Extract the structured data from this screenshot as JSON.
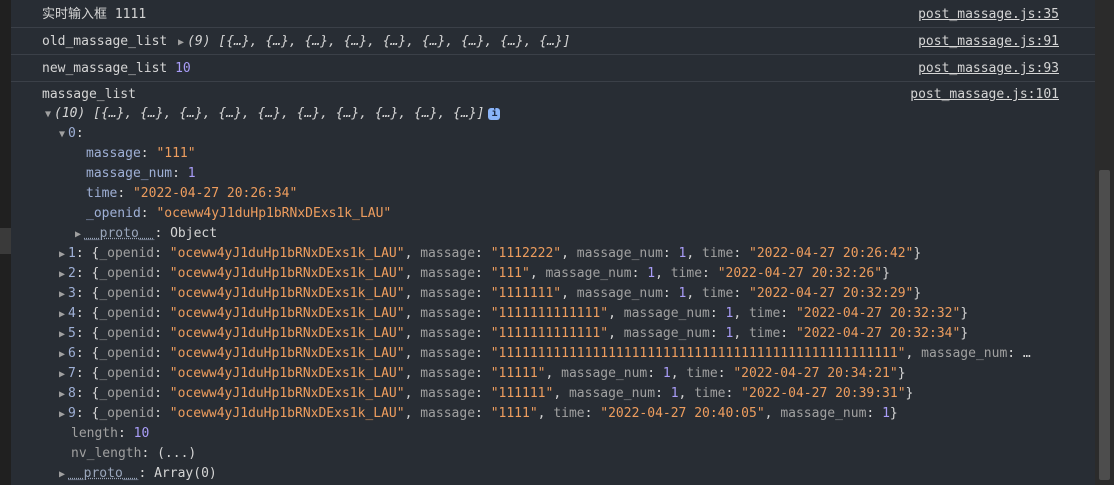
{
  "console": {
    "messages": [
      {
        "label": "实时输入框",
        "value": "1111",
        "source": "post_massage.js:35"
      },
      {
        "label": "old_massage_list",
        "count": "(9)",
        "preview": "[{…}, {…}, {…}, {…}, {…}, {…}, {…}, {…}, {…}]",
        "source": "post_massage.js:91"
      },
      {
        "label": "new_massage_list",
        "value": "10",
        "source": "post_massage.js:93"
      },
      {
        "label": "massage_list",
        "source": "post_massage.js:101"
      }
    ],
    "expanded": {
      "header_count": "(10)",
      "header_preview": "[{…}, {…}, {…}, {…}, {…}, {…}, {…}, {…}, {…}, {…}]",
      "info_icon": "i",
      "item0": {
        "index": "0",
        "props": [
          {
            "key": "massage",
            "value": "\"111\"",
            "type": "str"
          },
          {
            "key": "massage_num",
            "value": "1",
            "type": "num"
          },
          {
            "key": "time",
            "value": "\"2022-04-27 20:26:34\"",
            "type": "str"
          },
          {
            "key": "_openid",
            "value": "\"oceww4yJ1duHp1bRNxDExs1k_LAU\"",
            "type": "str"
          }
        ],
        "proto_label": "__proto__",
        "proto_value": "Object"
      },
      "rows": [
        {
          "index": "1",
          "openid": "\"oceww4yJ1duHp1bRNxDExs1k_LAU\"",
          "f2": "massage",
          "v2": "\"1112222\"",
          "f3": "massage_num",
          "v3": "1",
          "f4": "time",
          "v4": "\"2022-04-27 20:26:42\""
        },
        {
          "index": "2",
          "openid": "\"oceww4yJ1duHp1bRNxDExs1k_LAU\"",
          "f2": "massage",
          "v2": "\"111\"",
          "f3": "massage_num",
          "v3": "1",
          "f4": "time",
          "v4": "\"2022-04-27 20:32:26\""
        },
        {
          "index": "3",
          "openid": "\"oceww4yJ1duHp1bRNxDExs1k_LAU\"",
          "f2": "massage",
          "v2": "\"1111111\"",
          "f3": "massage_num",
          "v3": "1",
          "f4": "time",
          "v4": "\"2022-04-27 20:32:29\""
        },
        {
          "index": "4",
          "openid": "\"oceww4yJ1duHp1bRNxDExs1k_LAU\"",
          "f2": "massage",
          "v2": "\"1111111111111\"",
          "f3": "massage_num",
          "v3": "1",
          "f4": "time",
          "v4": "\"2022-04-27 20:32:32\""
        },
        {
          "index": "5",
          "openid": "\"oceww4yJ1duHp1bRNxDExs1k_LAU\"",
          "f2": "massage",
          "v2": "\"1111111111111\"",
          "f3": "massage_num",
          "v3": "1",
          "f4": "time",
          "v4": "\"2022-04-27 20:32:34\""
        },
        {
          "index": "7",
          "openid": "\"oceww4yJ1duHp1bRNxDExs1k_LAU\"",
          "f2": "massage",
          "v2": "\"11111\"",
          "f3": "massage_num",
          "v3": "1",
          "f4": "time",
          "v4": "\"2022-04-27 20:34:21\""
        },
        {
          "index": "8",
          "openid": "\"oceww4yJ1duHp1bRNxDExs1k_LAU\"",
          "f2": "massage",
          "v2": "\"111111\"",
          "f3": "massage_num",
          "v3": "1",
          "f4": "time",
          "v4": "\"2022-04-27 20:39:31\""
        }
      ],
      "row6": {
        "index": "6",
        "openid": "\"oceww4yJ1duHp1bRNxDExs1k_LAU\"",
        "f2": "massage",
        "v2": "\"111111111111111111111111111111111111111111111111111\"",
        "f3": "massage_num",
        "tail": ": …"
      },
      "row9": {
        "index": "9",
        "openid": "\"oceww4yJ1duHp1bRNxDExs1k_LAU\"",
        "f2": "massage",
        "v2": "\"1111\"",
        "f3": "time",
        "v3": "\"2022-04-27 20:40:05\"",
        "f4": "massage_num",
        "v4": "1"
      },
      "length_key": "length",
      "length_value": "10",
      "nv_length_key": "nv_length",
      "nv_length_value": "(...)",
      "array_proto_label": "__proto__",
      "array_proto_value": "Array(0)"
    }
  }
}
